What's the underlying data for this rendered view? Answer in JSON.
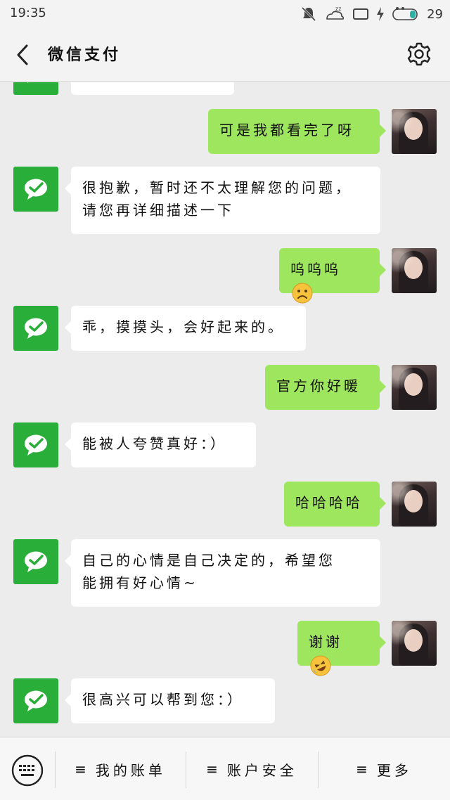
{
  "status_bar": {
    "time": "19:35",
    "battery_level": "29",
    "icons": [
      "mute-icon",
      "sleep-icon",
      "screen-icon",
      "charging-icon",
      "battery-icon"
    ]
  },
  "header": {
    "title": "微信支付",
    "back_icon": "chevron-left-icon",
    "settings_icon": "gear-icon"
  },
  "colors": {
    "bot_avatar": "#2aae3a",
    "user_bubble": "#9ee65e",
    "bot_bubble": "#ffffff",
    "background": "#ececec"
  },
  "messages": [
    {
      "from": "user",
      "text": "可是我都看完了呀"
    },
    {
      "from": "bot",
      "line1": "很抱歉，暂时还不太理解您的问题，",
      "line2": "请您再详细描述一下"
    },
    {
      "from": "user",
      "text": "呜呜呜",
      "emoji": "frowning-face-emoji"
    },
    {
      "from": "bot",
      "text": "乖，摸摸头，会好起来的。"
    },
    {
      "from": "user",
      "text": "官方你好暖"
    },
    {
      "from": "bot",
      "text": "能被人夸赞真好：）"
    },
    {
      "from": "user",
      "text": "哈哈哈哈"
    },
    {
      "from": "bot",
      "line1": "自己的心情是自己决定的，希望您",
      "line2": "能拥有好心情~"
    },
    {
      "from": "user",
      "text": "谢谢",
      "emoji": "rolling-laughing-emoji"
    },
    {
      "from": "bot",
      "text": "很高兴可以帮到您：）"
    }
  ],
  "bottom_menu": {
    "keyboard_icon": "keyboard-icon",
    "items": [
      {
        "label": "我的账单",
        "icon": "menu-icon"
      },
      {
        "label": "账户安全",
        "icon": "menu-icon"
      },
      {
        "label": "更多",
        "icon": "menu-icon"
      }
    ]
  }
}
